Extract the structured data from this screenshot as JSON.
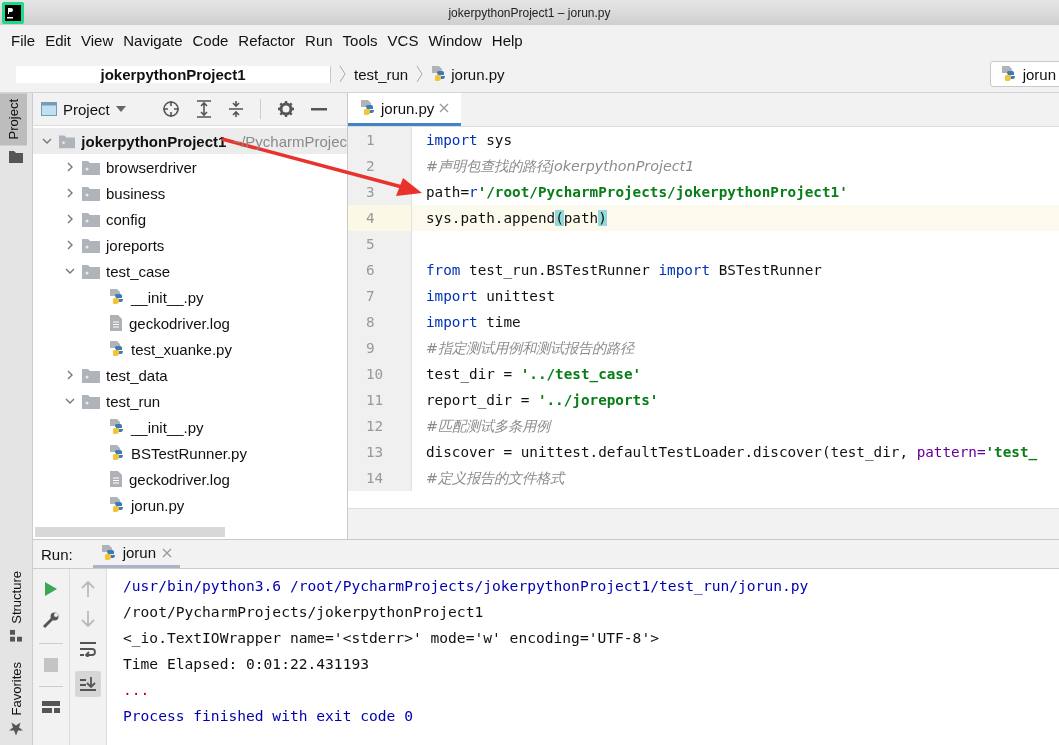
{
  "window": {
    "title": "jokerpythonProject1 – jorun.py"
  },
  "menu": [
    "File",
    "Edit",
    "View",
    "Navigate",
    "Code",
    "Refactor",
    "Run",
    "Tools",
    "VCS",
    "Window",
    "Help"
  ],
  "breadcrumbs": [
    {
      "label": "jokerpythonProject1",
      "kind": "project"
    },
    {
      "label": "test_run",
      "kind": "folder"
    },
    {
      "label": "jorun.py",
      "kind": "python"
    }
  ],
  "run_config": {
    "label": "jorun"
  },
  "side_tabs": [
    {
      "label": "Project",
      "selected": true
    }
  ],
  "bottom_side_tabs": [
    {
      "label": "Structure",
      "selected": false
    },
    {
      "label": "Favorites",
      "selected": false
    }
  ],
  "project_panel": {
    "title": "Project",
    "tree": [
      {
        "label": "jokerpythonProject1",
        "hint": "~/PycharmProjec",
        "kind": "folder",
        "expanded": true,
        "children": [
          {
            "label": "browserdriver",
            "kind": "folder",
            "expanded": false
          },
          {
            "label": "business",
            "kind": "folder",
            "expanded": false
          },
          {
            "label": "config",
            "kind": "folder",
            "expanded": false
          },
          {
            "label": "joreports",
            "kind": "folder",
            "expanded": false
          },
          {
            "label": "test_case",
            "kind": "folder",
            "expanded": true,
            "children": [
              {
                "label": "__init__.py",
                "kind": "python"
              },
              {
                "label": "geckodriver.log",
                "kind": "log"
              },
              {
                "label": "test_xuanke.py",
                "kind": "python"
              }
            ]
          },
          {
            "label": "test_data",
            "kind": "folder",
            "expanded": false
          },
          {
            "label": "test_run",
            "kind": "folder",
            "expanded": true,
            "children": [
              {
                "label": "__init__.py",
                "kind": "python"
              },
              {
                "label": "BSTestRunner.py",
                "kind": "python"
              },
              {
                "label": "geckodriver.log",
                "kind": "log"
              },
              {
                "label": "jorun.py",
                "kind": "python"
              }
            ]
          }
        ]
      }
    ]
  },
  "editor": {
    "tabs": [
      {
        "label": "jorun.py",
        "selected": true
      }
    ],
    "lines": [
      {
        "number": "1",
        "current": false,
        "tokens": [
          {
            "kind": "kw",
            "text": "import"
          },
          {
            "kind": "plain",
            "text": " sys"
          }
        ]
      },
      {
        "number": "2",
        "current": false,
        "tokens": [
          {
            "kind": "comment",
            "text": "#声明包查找的路径jokerpythonProject1"
          }
        ]
      },
      {
        "number": "3",
        "current": false,
        "tokens": [
          {
            "kind": "plain",
            "text": "path="
          },
          {
            "kind": "kw",
            "text": "r"
          },
          {
            "kind": "str",
            "text": "'/root/PycharmProjects/jokerpythonProject1'"
          }
        ]
      },
      {
        "number": "4",
        "current": true,
        "tokens": [
          {
            "kind": "plain",
            "text": "sys.path.append"
          },
          {
            "kind": "match",
            "text": "("
          },
          {
            "kind": "plain",
            "text": "path"
          },
          {
            "kind": "match",
            "text": ")"
          }
        ]
      },
      {
        "number": "5",
        "current": false
      },
      {
        "number": "6",
        "current": false,
        "tokens": [
          {
            "kind": "kw",
            "text": "from"
          },
          {
            "kind": "plain",
            "text": " test_run.BSTestRunner "
          },
          {
            "kind": "kw",
            "text": "import"
          },
          {
            "kind": "plain",
            "text": " BSTestRunner"
          }
        ]
      },
      {
        "number": "7",
        "current": false,
        "tokens": [
          {
            "kind": "kw",
            "text": "import"
          },
          {
            "kind": "plain",
            "text": " unittest"
          }
        ]
      },
      {
        "number": "8",
        "current": false,
        "tokens": [
          {
            "kind": "kw",
            "text": "import"
          },
          {
            "kind": "plain",
            "text": " time"
          }
        ]
      },
      {
        "number": "9",
        "current": false,
        "tokens": [
          {
            "kind": "comment",
            "text": "#指定测试用例和测试报告的路径"
          }
        ]
      },
      {
        "number": "10",
        "current": false,
        "tokens": [
          {
            "kind": "plain",
            "text": "test_dir = "
          },
          {
            "kind": "str",
            "text": "'../test_case'"
          }
        ]
      },
      {
        "number": "11",
        "current": false,
        "tokens": [
          {
            "kind": "plain",
            "text": "report_dir = "
          },
          {
            "kind": "str",
            "text": "'../joreports'"
          }
        ]
      },
      {
        "number": "12",
        "current": false,
        "tokens": [
          {
            "kind": "comment",
            "text": "#匹配测试多条用例"
          }
        ]
      },
      {
        "number": "13",
        "current": false,
        "tokens": [
          {
            "kind": "plain",
            "text": "discover = unittest.defaultTestLoader.discover(test_dir, "
          },
          {
            "kind": "param",
            "text": "pattern="
          },
          {
            "kind": "str",
            "text": "'test_"
          }
        ]
      },
      {
        "number": "14",
        "current": false,
        "tokens": [
          {
            "kind": "comment",
            "text": "#定义报告的文件格式"
          }
        ]
      }
    ]
  },
  "run_panel": {
    "label": "Run:",
    "tabs": [
      {
        "label": "jorun",
        "selected": true
      }
    ],
    "output": [
      {
        "kind": "info",
        "text": "/usr/bin/python3.6 /root/PycharmProjects/jokerpythonProject1/test_run/jorun.py"
      },
      {
        "kind": "plain",
        "text": "/root/PycharmProjects/jokerpythonProject1"
      },
      {
        "kind": "plain",
        "text": "<_io.TextIOWrapper name='<stderr>' mode='w' encoding='UTF-8'>"
      },
      {
        "kind": "plain",
        "text": "Time Elapsed: 0:01:22.431193"
      },
      {
        "kind": "error",
        "text": "..."
      },
      {
        "kind": "info",
        "text": "Process finished with exit code 0"
      }
    ]
  }
}
